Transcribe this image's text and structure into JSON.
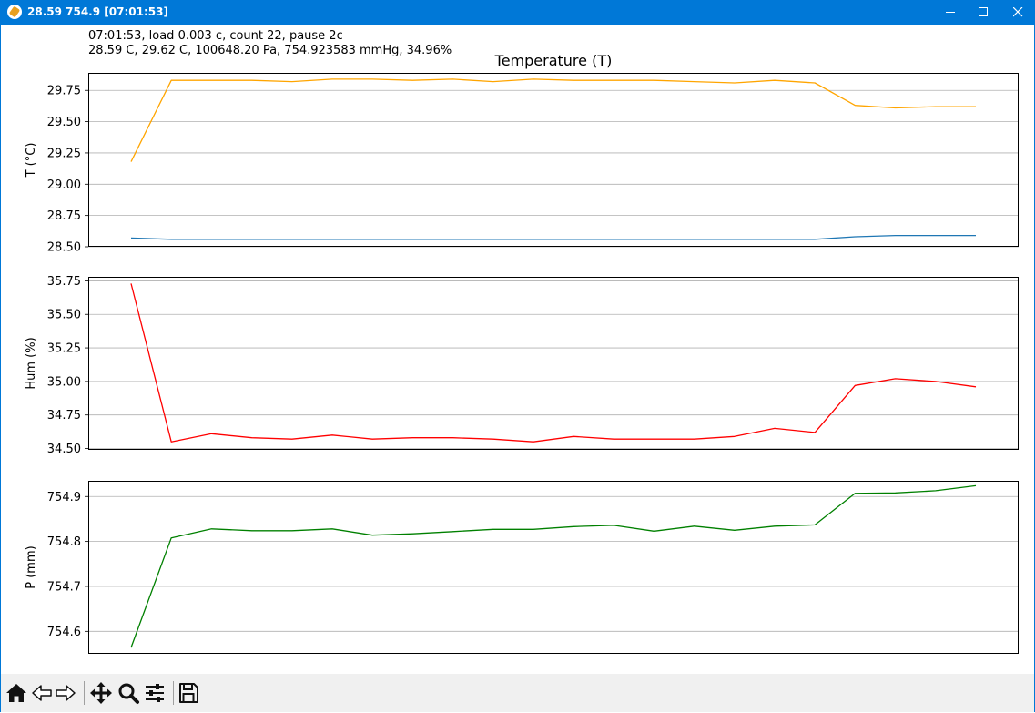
{
  "window": {
    "title": "28.59 754.9 [07:01:53]"
  },
  "status": {
    "line1": "07:01:53, load 0.003 c, count 22, pause 2c",
    "line2": "28.59 C, 29.62 C, 100648.20 Pa, 754.923583 mmHg, 34.96%"
  },
  "toolbar": {
    "buttons": [
      "home",
      "back",
      "forward",
      "pan",
      "zoom",
      "configure-subplots",
      "save"
    ]
  },
  "chart_data": [
    {
      "type": "line",
      "title": "Temperature (T)",
      "ylabel": "T (°C)",
      "ylim": [
        28.5,
        29.89
      ],
      "yticks": [
        28.5,
        28.75,
        29.0,
        29.25,
        29.5,
        29.75
      ],
      "ytick_labels": [
        "28.50",
        "28.75",
        "29.00",
        "29.25",
        "29.50",
        "29.75"
      ],
      "grid": true,
      "series": [
        {
          "color": "#ffa500",
          "values": [
            29.18,
            29.83,
            29.83,
            29.83,
            29.82,
            29.84,
            29.84,
            29.83,
            29.84,
            29.82,
            29.84,
            29.83,
            29.83,
            29.83,
            29.82,
            29.81,
            29.83,
            29.81,
            29.63,
            29.61,
            29.62,
            29.62
          ]
        },
        {
          "color": "#1f77b4",
          "values": [
            28.57,
            28.56,
            28.56,
            28.56,
            28.56,
            28.56,
            28.56,
            28.56,
            28.56,
            28.56,
            28.56,
            28.56,
            28.56,
            28.56,
            28.56,
            28.56,
            28.56,
            28.56,
            28.58,
            28.59,
            28.59,
            28.59
          ]
        }
      ]
    },
    {
      "type": "line",
      "ylabel": "Hum (%)",
      "ylim": [
        34.49,
        35.78
      ],
      "yticks": [
        34.5,
        34.75,
        35.0,
        35.25,
        35.5,
        35.75
      ],
      "ytick_labels": [
        "34.50",
        "34.75",
        "35.00",
        "35.25",
        "35.50",
        "35.75"
      ],
      "grid": true,
      "series": [
        {
          "color": "#ff0000",
          "values": [
            35.73,
            34.55,
            34.61,
            34.58,
            34.57,
            34.6,
            34.57,
            34.58,
            34.58,
            34.57,
            34.55,
            34.59,
            34.57,
            34.57,
            34.57,
            34.59,
            34.65,
            34.62,
            34.97,
            35.02,
            35.0,
            34.96
          ]
        }
      ]
    },
    {
      "type": "line",
      "ylabel": "P (mm)",
      "ylim": [
        754.55,
        754.935
      ],
      "yticks": [
        754.6,
        754.7,
        754.8,
        754.9
      ],
      "ytick_labels": [
        "754.6",
        "754.7",
        "754.8",
        "754.9"
      ],
      "grid": true,
      "series": [
        {
          "color": "#008000",
          "values": [
            754.564,
            754.808,
            754.828,
            754.824,
            754.824,
            754.828,
            754.814,
            754.817,
            754.822,
            754.827,
            754.827,
            754.833,
            754.836,
            754.823,
            754.834,
            754.825,
            754.834,
            754.837,
            754.907,
            754.908,
            754.913,
            754.924
          ]
        }
      ]
    }
  ]
}
